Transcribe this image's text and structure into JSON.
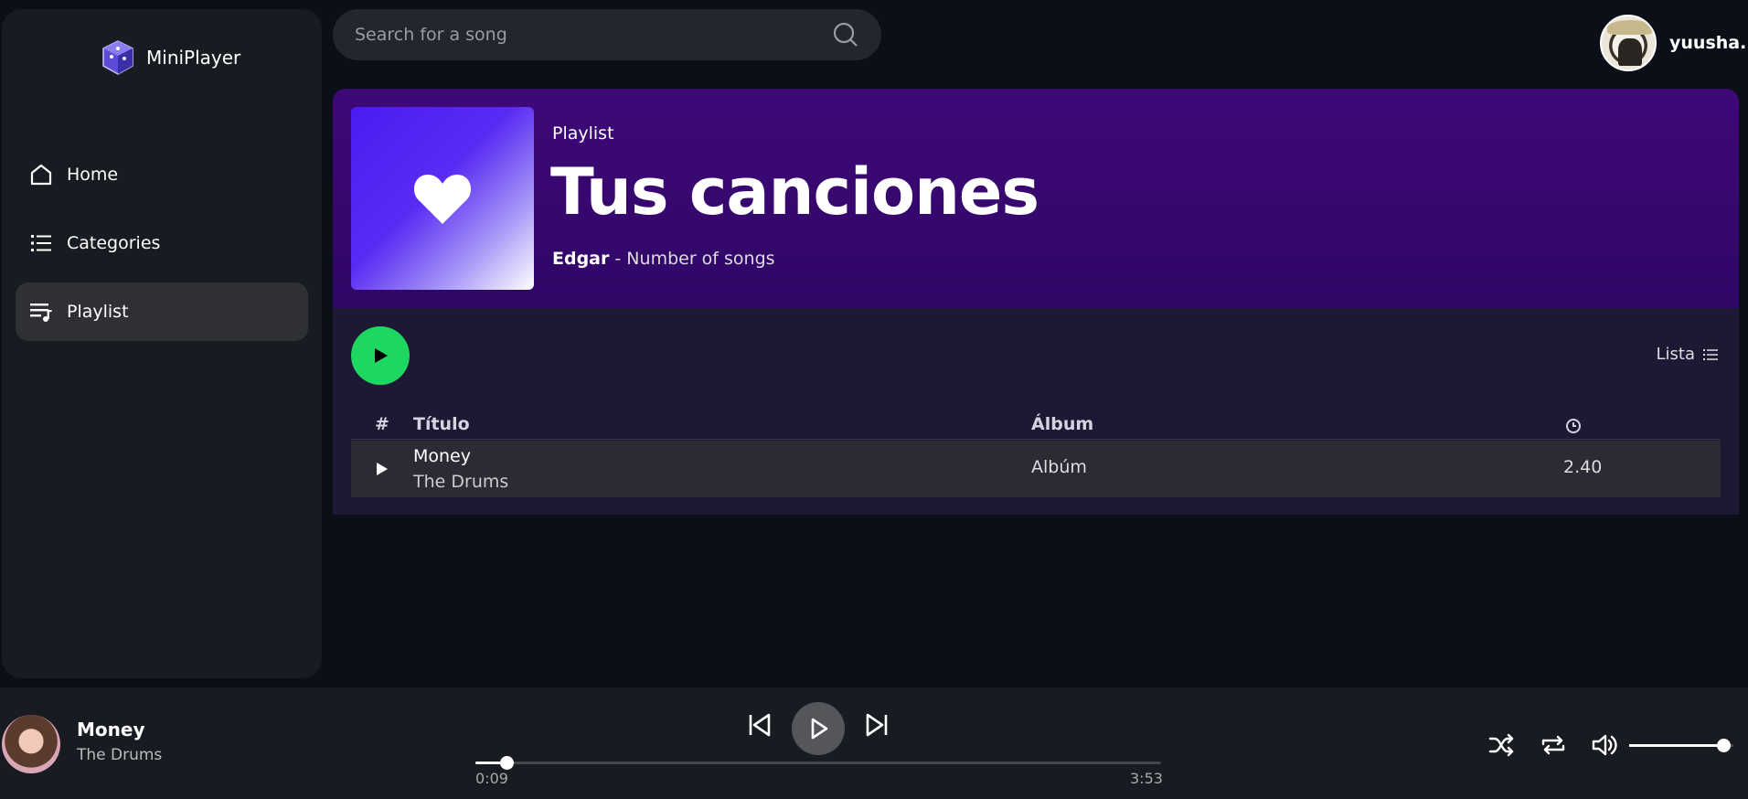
{
  "app": {
    "name": "MiniPlayer"
  },
  "sidebar": {
    "items": [
      {
        "label": "Home",
        "icon": "home-icon"
      },
      {
        "label": "Categories",
        "icon": "list-icon"
      },
      {
        "label": "Playlist",
        "icon": "playlist-icon",
        "active": true
      }
    ]
  },
  "search": {
    "placeholder": "Search for a song"
  },
  "user": {
    "name": "yuusha..."
  },
  "playlist": {
    "type": "Playlist",
    "title": "Tus canciones",
    "owner": "Edgar",
    "meta": " - Number of songs",
    "view_label": "Lista"
  },
  "table": {
    "headers": {
      "index": "#",
      "title": "Título",
      "album": "Álbum",
      "duration_icon": "clock-icon"
    },
    "rows": [
      {
        "title": "Money",
        "artist": "The Drums",
        "album": "Albúm",
        "duration": "2.40"
      }
    ]
  },
  "player": {
    "title": "Money",
    "artist": "The Drums",
    "current_time": "0:09",
    "total_time": "3:53",
    "progress": 0.045,
    "volume": 0.9
  },
  "colors": {
    "accent_green": "#1ed760",
    "header_purple": "#3f0877",
    "panel": "#1d1833",
    "sidebar": "#181b22"
  }
}
